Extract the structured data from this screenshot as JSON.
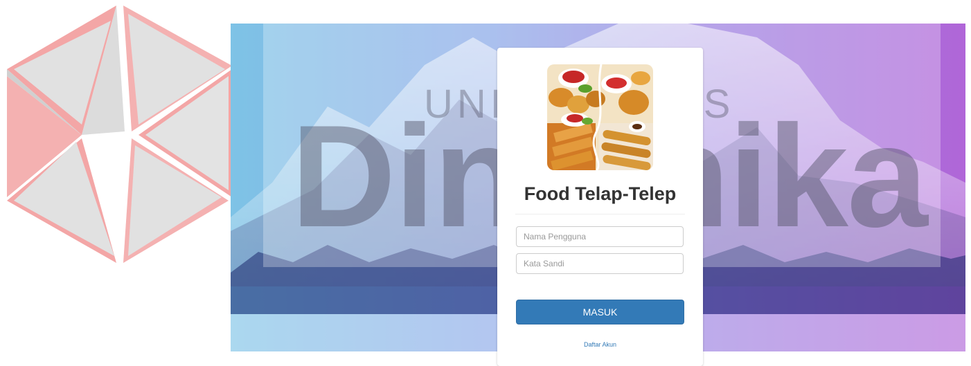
{
  "watermark": {
    "university_label": "UNIVERSITAS",
    "brand_label": "Dinamika"
  },
  "login": {
    "app_title": "Food Telap-Telep",
    "username_placeholder": "Nama Pengguna",
    "password_placeholder": "Kata Sandi",
    "submit_label": "MASUK",
    "register_link": "Daftar Akun"
  },
  "colors": {
    "primary_button": "#337ab7",
    "background_gradient_start": "#7ec3e6",
    "background_gradient_end": "#b066d8",
    "logo_red": "#e33b3b",
    "logo_gray": "#c8c8c8"
  },
  "icons": [
    "university-star-logo",
    "food-photo"
  ]
}
